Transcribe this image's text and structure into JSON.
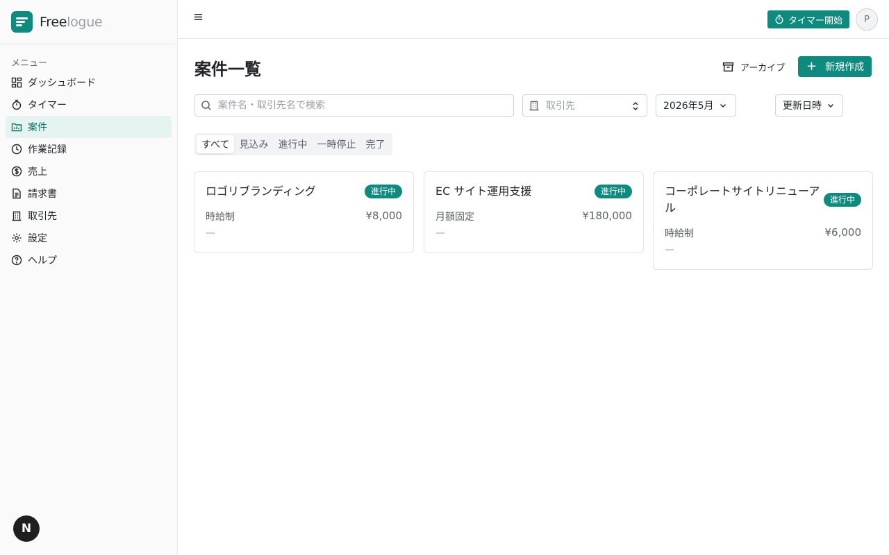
{
  "app": {
    "brand_part1": "Free",
    "brand_part2": "logue",
    "accent_color": "#0f8a7e"
  },
  "sidebar": {
    "heading": "メニュー",
    "items": [
      {
        "label": "ダッシュボード",
        "icon": "dashboard-icon",
        "active": false
      },
      {
        "label": "タイマー",
        "icon": "timer-icon",
        "active": false
      },
      {
        "label": "案件",
        "icon": "folder-icon",
        "active": true
      },
      {
        "label": "作業記録",
        "icon": "clock-icon",
        "active": false
      },
      {
        "label": "売上",
        "icon": "dollar-circle-icon",
        "active": false
      },
      {
        "label": "請求書",
        "icon": "document-icon",
        "active": false
      },
      {
        "label": "取引先",
        "icon": "building-icon",
        "active": false
      },
      {
        "label": "設定",
        "icon": "gear-icon",
        "active": false
      },
      {
        "label": "ヘルプ",
        "icon": "help-circle-icon",
        "active": false
      }
    ],
    "footer_badge": "N"
  },
  "header": {
    "menu_icon": "hamburger-icon",
    "timer_button": "タイマー開始",
    "avatar_initial": "P"
  },
  "main": {
    "title": "案件一覧",
    "archive_button": "アーカイブ",
    "new_button": "新規作成",
    "search_placeholder": "案件名・取引先名で検索",
    "client_filter_placeholder": "取引先",
    "month_filter": "2026年5月",
    "sort_select": "更新日時",
    "tabs": [
      {
        "label": "すべて",
        "active": true
      },
      {
        "label": "見込み",
        "active": false
      },
      {
        "label": "進行中",
        "active": false
      },
      {
        "label": "一時停止",
        "active": false
      },
      {
        "label": "完了",
        "active": false
      }
    ],
    "projects": [
      {
        "title": "ロゴリブランディング",
        "status": "進行中",
        "rate_type": "時給制",
        "amount": "¥8,000",
        "note": "—"
      },
      {
        "title": "EC サイト運用支援",
        "status": "進行中",
        "rate_type": "月額固定",
        "amount": "¥180,000",
        "note": "—"
      },
      {
        "title": "コーポレートサイトリニューアル",
        "status": "進行中",
        "rate_type": "時給制",
        "amount": "¥6,000",
        "note": "—"
      }
    ]
  }
}
